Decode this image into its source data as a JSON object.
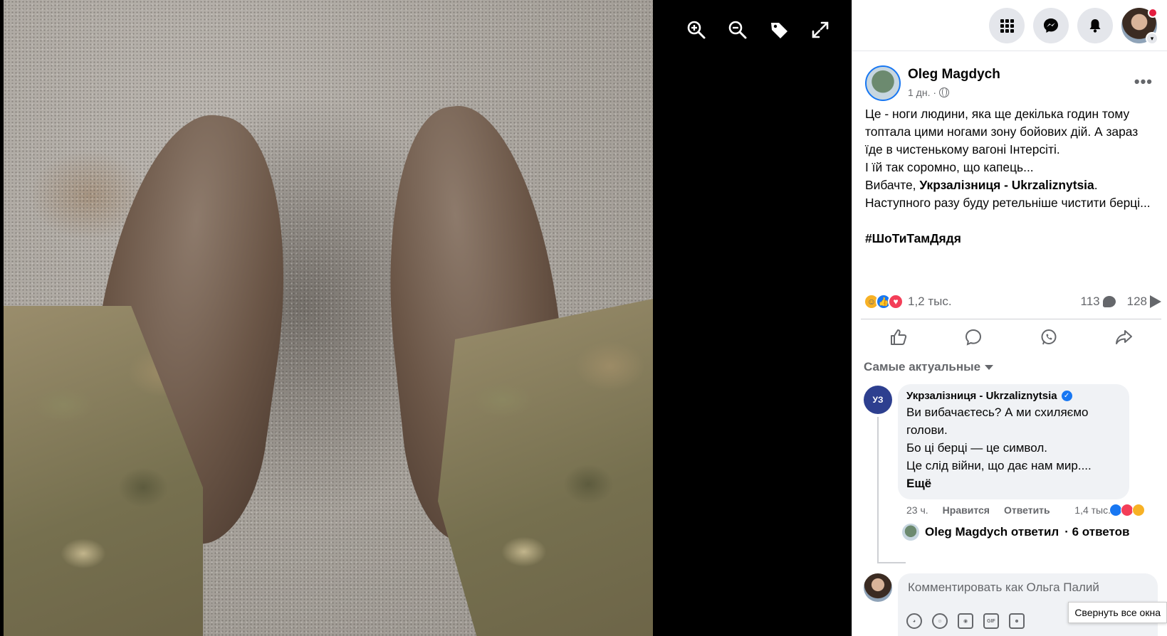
{
  "viewer": {
    "photo_alt": "",
    "tools": [
      {
        "icon": "zoom-in-icon"
      },
      {
        "icon": "zoom-out-icon"
      },
      {
        "icon": "tag-icon"
      },
      {
        "icon": "fullscreen-icon"
      }
    ]
  },
  "topbar": {
    "icons": [
      "menu-grid-icon",
      "messenger-icon",
      "notifications-bell-icon",
      "account-avatar"
    ],
    "notification_color": "#e41e3f"
  },
  "post": {
    "author": "Oleg Magdych",
    "time": "1 дн. ·",
    "privacy_icon": "globe-icon",
    "text_lines": [
      "Це - ноги людини, яка ще декілька годин тому топтала цими ногами зону бойових дій. А зараз їде в чистенькому вагоні Інтерсіті.",
      "І їй так соромно, що капець..."
    ],
    "apology_prefix": "Вибачте, ",
    "apology_mention": "Укрзалізниця - Ukrzaliznytsia",
    "apology_suffix": ".",
    "closing_line": "Наступного разу буду ретельніше чистити берці...",
    "hashtag": "#ШоТиТамДядя",
    "reactions_count": "1,2 тыс.",
    "comments_count": "113",
    "shares_count": "128"
  },
  "sort_label": "Самые актуальные",
  "comment": {
    "avatar_text": "УЗ",
    "author": "Укрзалізниця - Ukrzaliznytsia",
    "lines": [
      "Ви вибачаєтесь? А ми схиляємо голови.",
      "Бо ці берці — це символ.",
      "Це слід війни, що дає нам мир...."
    ],
    "more": "Ещё",
    "time": "23 ч.",
    "like_label": "Нравится",
    "reply_label": "Ответить",
    "reactions_count": "1,4 тыс.",
    "reply_summary_name": "Oleg Magdych ответил",
    "reply_summary_count": "· 6 ответов"
  },
  "composer": {
    "placeholder": "Комментировать как Ольга Палий",
    "tools": [
      "avatar-sticker-icon",
      "emoji-icon",
      "camera-icon",
      "gif-icon",
      "sticker-icon"
    ]
  },
  "tooltip": "Свернуть все окна",
  "colors": {
    "accent": "#1877f2",
    "like": "#1877f2",
    "love": "#f33e58",
    "care": "#f7b125"
  }
}
